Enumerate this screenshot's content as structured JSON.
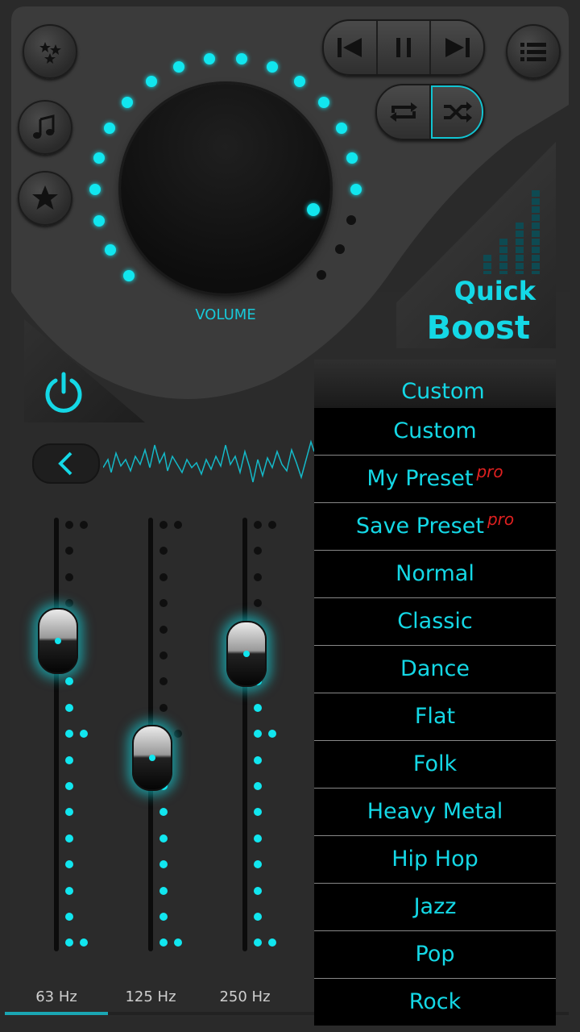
{
  "colors": {
    "accent": "#11e6ef",
    "pro": "#e02020",
    "background": "#2e2e2e"
  },
  "volume": {
    "label": "VOLUME",
    "level": 0.85
  },
  "boost": {
    "line1": "Quick",
    "line2": "Boost"
  },
  "nav_buttons": {
    "favorites_icon": "stars-icon",
    "music_icon": "music-note-icon",
    "star_icon": "star-icon",
    "menu_icon": "list-menu-icon"
  },
  "transport": {
    "prev_icon": "skip-previous-icon",
    "pause_icon": "pause-icon",
    "next_icon": "skip-next-icon",
    "repeat_icon": "repeat-icon",
    "shuffle_icon": "shuffle-icon"
  },
  "equalizer": {
    "bands": [
      {
        "label": "63 Hz",
        "level": 0.72
      },
      {
        "label": "125 Hz",
        "level": 0.45
      },
      {
        "label": "250 Hz",
        "level": 0.69
      }
    ]
  },
  "preset": {
    "current": "Custom",
    "pro_tag": "pro",
    "items": [
      {
        "label": "Custom",
        "pro": false
      },
      {
        "label": "My Preset",
        "pro": true
      },
      {
        "label": "Save Preset",
        "pro": true
      },
      {
        "label": "Normal",
        "pro": false
      },
      {
        "label": "Classic",
        "pro": false
      },
      {
        "label": "Dance",
        "pro": false
      },
      {
        "label": "Flat",
        "pro": false
      },
      {
        "label": "Folk",
        "pro": false
      },
      {
        "label": "Heavy Metal",
        "pro": false
      },
      {
        "label": "Hip Hop",
        "pro": false
      },
      {
        "label": "Jazz",
        "pro": false
      },
      {
        "label": "Pop",
        "pro": false
      },
      {
        "label": "Rock",
        "pro": false
      }
    ]
  }
}
